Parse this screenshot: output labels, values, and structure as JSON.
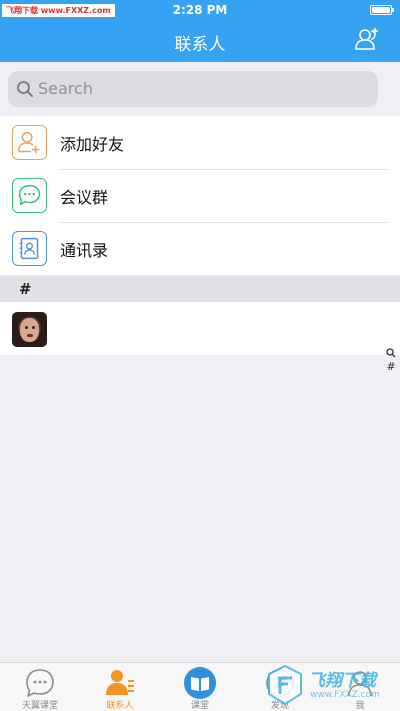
{
  "status_bar": {
    "watermark": "飞翔下载 www.FXXZ.com",
    "time": "2:28 PM"
  },
  "nav": {
    "title": "联系人",
    "action_icon": "add-contact-icon"
  },
  "search": {
    "placeholder": "Search"
  },
  "menu_items": [
    {
      "label": "添加好友",
      "icon": "add-friend-icon",
      "color": "#f0a060"
    },
    {
      "label": "会议群",
      "icon": "meeting-group-icon",
      "color": "#3cc07a"
    },
    {
      "label": "通讯录",
      "icon": "address-book-icon",
      "color": "#5a8fd6"
    }
  ],
  "section": {
    "label": "#"
  },
  "contacts": [
    {
      "name": "",
      "avatar": "child-photo-avatar"
    }
  ],
  "index_bar": [
    "#"
  ],
  "tabs": [
    {
      "label": "天翼课堂",
      "icon": "chat-bubble-icon",
      "active": false
    },
    {
      "label": "联系人",
      "icon": "contacts-icon",
      "active": true
    },
    {
      "label": "课堂",
      "icon": "book-icon",
      "active": false
    },
    {
      "label": "发现",
      "icon": "discover-icon",
      "active": false
    },
    {
      "label": "我",
      "icon": "me-icon",
      "active": false
    }
  ],
  "watermark_bottom": {
    "brand": "飞翔下载",
    "url": "www.FXXZ.com"
  },
  "colors": {
    "header": "#35a2f4",
    "active_tab": "#f39425"
  }
}
